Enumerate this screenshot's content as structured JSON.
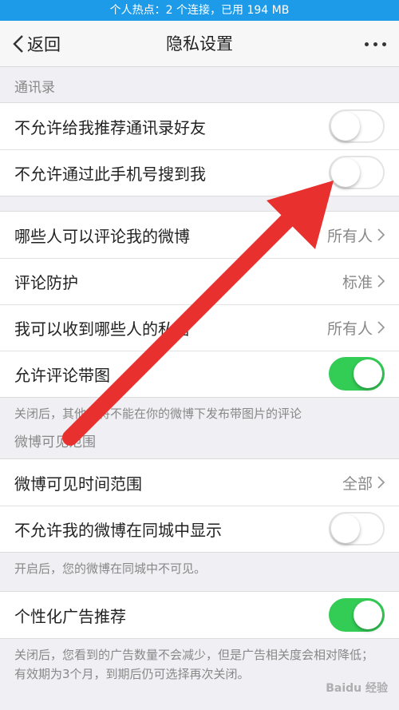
{
  "status_bar": {
    "text": "个人热点：2 个连接，已用 194 MB"
  },
  "nav": {
    "back_label": "返回",
    "title": "隐私设置"
  },
  "sections": {
    "contacts": {
      "header": "通讯录",
      "rows": [
        {
          "label": "不允许给我推荐通讯录好友",
          "toggle": "off"
        },
        {
          "label": "不允许通过此手机号搜到我",
          "toggle": "off"
        }
      ]
    },
    "comments": {
      "rows": [
        {
          "label": "哪些人可以评论我的微博",
          "value": "所有人"
        },
        {
          "label": "评论防护",
          "value": "标准"
        },
        {
          "label": "我可以收到哪些人的私信",
          "value": "所有人"
        },
        {
          "label": "允许评论带图",
          "toggle": "on"
        }
      ],
      "note": "关闭后，其他人将不能在你的微博下发布带图片的评论"
    },
    "visibility": {
      "header": "微博可见范围",
      "rows": [
        {
          "label": "微博可见时间范围",
          "value": "全部"
        },
        {
          "label": "不允许我的微博在同城中显示",
          "toggle": "off"
        }
      ],
      "note": "开启后，您的微博在同城中不可见。"
    },
    "ads": {
      "rows": [
        {
          "label": "个性化广告推荐",
          "toggle": "on"
        }
      ],
      "note": "关闭后，您看到的广告数量不会减少，但是广告相关度会相对降低；有效期为3个月，到期后仍可选择再次关闭。"
    }
  },
  "watermark": "Baidu 经验",
  "colors": {
    "status_bar": "#1e9be8",
    "toggle_on": "#33cc55",
    "arrow": "#e8312f"
  }
}
